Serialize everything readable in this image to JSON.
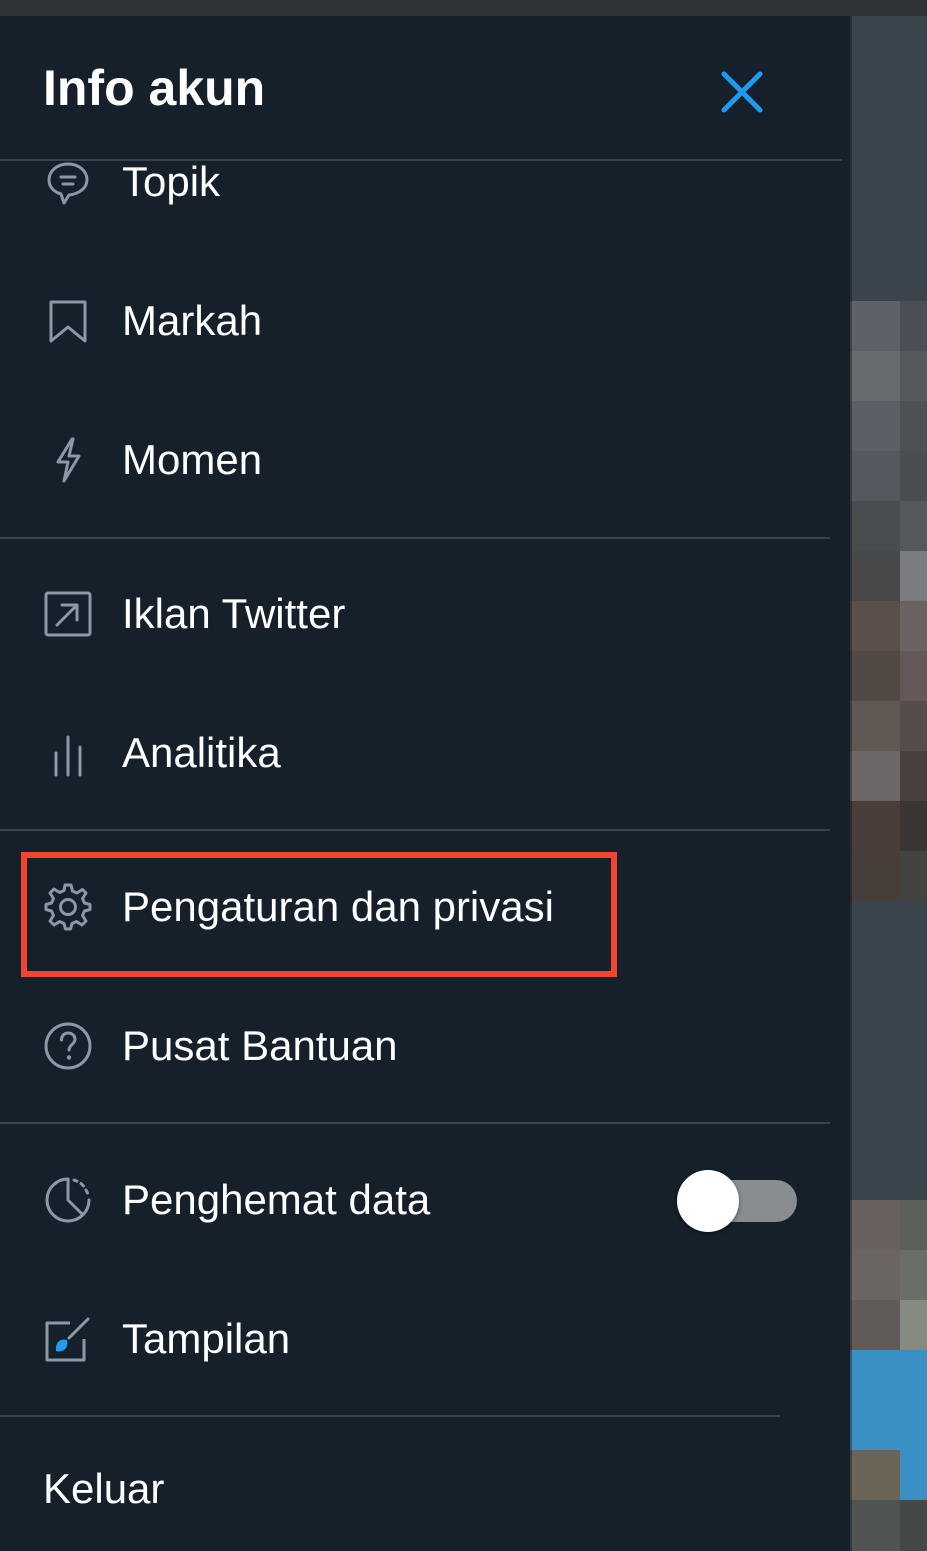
{
  "header": {
    "title": "Info akun",
    "close_icon": "close-icon",
    "accent_color": "#1d9bf0"
  },
  "menu": [
    {
      "label": "Topik",
      "icon": "topic-icon"
    },
    {
      "label": "Markah",
      "icon": "bookmark-icon"
    },
    {
      "label": "Momen",
      "icon": "lightning-icon"
    },
    {
      "label": "Iklan Twitter",
      "icon": "external-link-icon"
    },
    {
      "label": "Analitika",
      "icon": "analytics-icon"
    },
    {
      "label": "Pengaturan dan privasi",
      "icon": "gear-icon",
      "highlighted": true
    },
    {
      "label": "Pusat Bantuan",
      "icon": "help-icon"
    },
    {
      "label": "Penghemat data",
      "icon": "data-saver-icon",
      "toggle_on": false
    },
    {
      "label": "Tampilan",
      "icon": "display-icon"
    }
  ],
  "logout": {
    "label": "Keluar"
  },
  "colors": {
    "background": "#15202b",
    "divider": "#38444d",
    "highlight_border": "#f2452f",
    "icon": "#8b98a5"
  }
}
